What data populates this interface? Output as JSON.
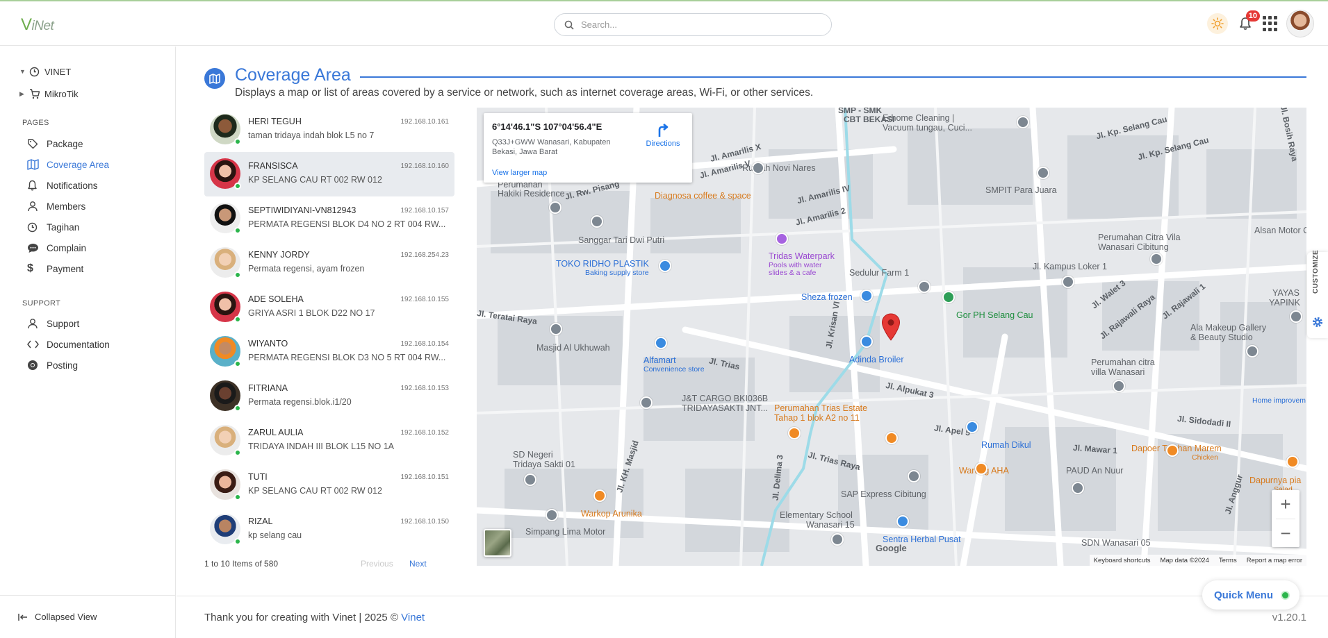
{
  "app": {
    "brand_mark": "V",
    "brand_rest": "iNet"
  },
  "search": {
    "placeholder": "Search..."
  },
  "topbar": {
    "notif_count": "10"
  },
  "sidebar": {
    "top_items": [
      {
        "label": "VINET"
      },
      {
        "label": "MikroTik"
      }
    ],
    "pages_label": "PAGES",
    "pages": [
      {
        "label": "Package"
      },
      {
        "label": "Coverage Area"
      },
      {
        "label": "Notifications"
      },
      {
        "label": "Members"
      },
      {
        "label": "Tagihan"
      },
      {
        "label": "Complain"
      },
      {
        "label": "Payment"
      }
    ],
    "support_label": "SUPPORT",
    "support": [
      {
        "label": "Support"
      },
      {
        "label": "Documentation"
      },
      {
        "label": "Posting"
      }
    ],
    "collapsed_label": "Collapsed View"
  },
  "page": {
    "title": "Coverage Area",
    "description": "Displays a map or list of areas covered by a service or network, such as internet coverage areas, Wi-Fi, or other services."
  },
  "customers": [
    {
      "name": "HERI TEGUH",
      "address": "taman tridaya indah blok L5 no 7",
      "ip": "192.168.10.161"
    },
    {
      "name": "FRANSISCA",
      "address": "KP SELANG CAU RT 002 RW 012",
      "ip": "192.168.10.160"
    },
    {
      "name": "SEPTIWIDIYANI-VN812943",
      "address": "PERMATA REGENSI BLOK D4 NO 2 RT 004 RW...",
      "ip": "192.168.10.157"
    },
    {
      "name": "KENNY JORDY",
      "address": "Permata regensi, ayam frozen",
      "ip": "192.168.254.23"
    },
    {
      "name": "ADE SOLEHA",
      "address": "GRIYA ASRI 1 BLOK D22 NO 17",
      "ip": "192.168.10.155"
    },
    {
      "name": "WIYANTO",
      "address": "PERMATA REGENSI BLOK D3 NO 5 RT 004 RW...",
      "ip": "192.168.10.154"
    },
    {
      "name": "FITRIANA",
      "address": "Permata regensi.blok.i1/20",
      "ip": "192.168.10.153"
    },
    {
      "name": "ZARUL AULIA",
      "address": "TRIDAYA INDAH III BLOK L15 NO 1A",
      "ip": "192.168.10.152"
    },
    {
      "name": "TUTI",
      "address": "KP SELANG CAU RT 002 RW 012",
      "ip": "192.168.10.151"
    },
    {
      "name": "RIZAL",
      "address": "kp selang cau",
      "ip": "192.168.10.150"
    }
  ],
  "pagination": {
    "count": "1 to 10 Items of 580",
    "prev": "Previous",
    "next": "Next"
  },
  "map": {
    "coord": "6°14'46.1\"S 107°04'56.4\"E",
    "plus_code": "Q33J+GWW Wanasari, Kabupaten Bekasi, Jawa Barat",
    "view_larger": "View larger map",
    "directions": "Directions",
    "google": "Google",
    "attrib": [
      "Keyboard shortcuts",
      "Map data ©2024",
      "Terms",
      "Report a map error"
    ],
    "labels": {
      "smp": "SMP - SMK",
      "cbt": "CBT BEKASI",
      "erhome1": "Erhome Cleaning |",
      "erhome2": "Vacuum tungau, Cuci...",
      "selang1": "Jl. Kp. Selang Cau",
      "selang2": "Jl. Kp. Selang Cau",
      "bosih": "Jl. Bosih Raya",
      "amarilis_x": "Jl. Amarilis X",
      "amarilis_v": "Jl. Amarilis V",
      "amarilis_iv": "Jl. Amarilis IV",
      "amarilis_2": "Jl. Amarilis 2",
      "novi": "Rumah Novi Nares",
      "permahan": "Perumahan",
      "hakiki": "Hakiki Residence",
      "pisang": "Jl. Rw. Pisang",
      "diagnosa": "Diagnosa coffee & space",
      "smpit": "SMPIT Para Juara",
      "sanggar": "Sanggar Tari Dwi Putri",
      "tridas": "Tridas Waterpark",
      "tridas_sub1": "Pools with water",
      "tridas_sub2": "slides & a cafe",
      "citra1": "Perumahan Citra Vila",
      "citra2": "Wanasari Cibitung",
      "alsan": "Alsan Motor Cil",
      "toko": "TOKO RIDHO PLASTIK",
      "toko_sub": "Baking supply store",
      "sedulur": "Sedulur Farm 1",
      "kampus": "Jl. Kampus Loker 1",
      "sheza": "Sheza frozen",
      "gorph": "Gor PH Selang Cau",
      "walet": "Jl. Walet 3",
      "rajawali": "Jl. Rajawali Raya",
      "rajawali1": "Jl. Rajawali 1",
      "yayas": "YAYAS",
      "yapink": "YAPINK",
      "teratai": "Jl. Teratai Raya",
      "masjid": "Masjid Al Ukhuwah",
      "alfamart": "Alfamart",
      "alfamart_sub": "Convenience store",
      "trias": "Jl. Trias",
      "krisan": "Jl. Krisan VI",
      "adinda": "Adinda Broiler",
      "ala1": "Ala Makeup Gallery",
      "ala2": "& Beauty Studio",
      "perum_citra1": "Perumahan citra",
      "perum_citra2": "villa Wanasari",
      "alpukat": "Jl. Alpukat 3",
      "home_imp": "Home improvem",
      "jt1": "J&T CARGO BKI036B",
      "jt2": "TRIDAYASAKTI JNT...",
      "trias_estate1": "Perumahan Trias Estate",
      "trias_estate2": "Tahap 1 blok A2 no 11",
      "apel": "Jl. Apel 5",
      "dikul": "Rumah Dikul",
      "mawar": "Jl. Mawar 1",
      "sidodadi": "Jl. Sidodadi II",
      "dapoer1": "Dapoer Taichan Marem",
      "dapoer2": "Chicken",
      "masjid_kh": "Jl. KH. Masjid",
      "sdn1": "SD Negeri",
      "sdn2": "Tridaya Sakti 01",
      "delima": "Jl. Delima 3",
      "trias_raya": "Jl. Trias Raya",
      "warung": "Warung AHA",
      "paud": "PAUD An Nuur",
      "dapurnya1": "Dapurnya pia",
      "dapurnya2": "Salad",
      "sap": "SAP Express Cibitung",
      "warkop": "Warkop Arunika",
      "elem1": "Elementary School",
      "elem2": "Wanasari 15",
      "anggur": "Jl. Anggur",
      "simpang": "Simpang Lima Motor",
      "sentra": "Sentra Herbal Pusat",
      "sdn05": "SDN Wanasari 05"
    }
  },
  "customize": {
    "label": "CUSTOMIZE"
  },
  "footer": {
    "thanks": "Thank you for creating with Vinet | 2025 © ",
    "link": "Vinet",
    "version": "v1.20.1"
  },
  "quick_menu": {
    "label": "Quick Menu"
  },
  "colors": {
    "accent": "#3a78d8",
    "online": "#2bb54b",
    "badge": "#e53935"
  }
}
